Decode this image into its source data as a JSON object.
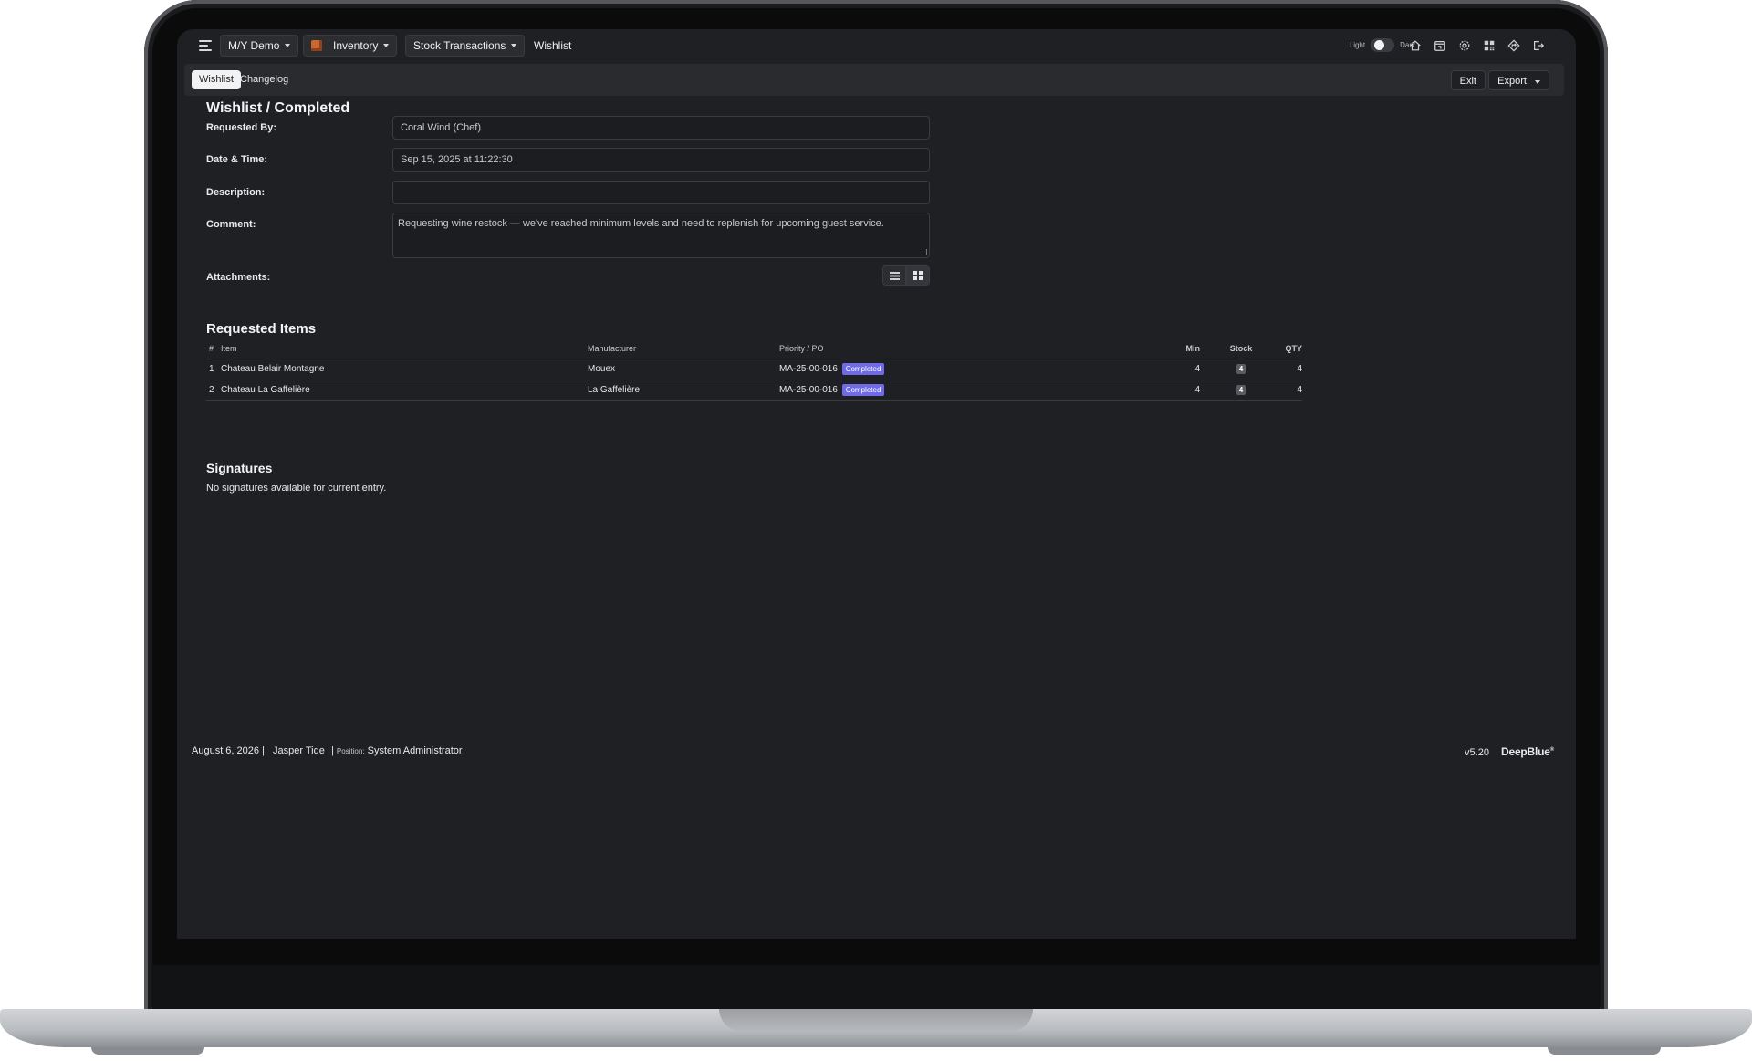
{
  "topnav": {
    "vessel": "M/Y Demo",
    "module": "Inventory",
    "section": "Stock Transactions",
    "page": "Wishlist",
    "theme_light": "Light",
    "theme_dark": "Dark"
  },
  "subbar": {
    "tabs": [
      "Wishlist",
      "Changelog"
    ],
    "exit_label": "Exit",
    "export_label": "Export"
  },
  "form": {
    "title": "Wishlist / Completed",
    "requested_by_label": "Requested By:",
    "requested_by_value": "Coral Wind (Chef)",
    "datetime_label": "Date & Time:",
    "datetime_value": "Sep 15, 2025 at 11:22:30",
    "description_label": "Description:",
    "description_value": "",
    "comment_label": "Comment:",
    "comment_value": "Requesting wine restock — we've reached minimum levels and need to replenish for upcoming guest service.",
    "attachments_label": "Attachments:"
  },
  "items": {
    "title": "Requested Items",
    "headers": [
      "#",
      "Item",
      "Manufacturer",
      "Priority / PO",
      "Min",
      "Stock",
      "QTY"
    ],
    "rows": [
      {
        "num": "1",
        "item": "Chateau Belair Montagne",
        "manufacturer": "Mouex",
        "po": "MA-25-00-016",
        "status": "Completed",
        "min": "4",
        "stock": "4",
        "qty": "4"
      },
      {
        "num": "2",
        "item": "Chateau La Gaffelière",
        "manufacturer": "La Gaffelière",
        "po": "MA-25-00-016",
        "status": "Completed",
        "min": "4",
        "stock": "4",
        "qty": "4"
      }
    ]
  },
  "signatures": {
    "title": "Signatures",
    "empty_text": "No signatures available for current entry."
  },
  "footer": {
    "date": "August 6, 2026",
    "user": "Jasper Tide",
    "position_label": "Position:",
    "position_value": "System Administrator",
    "version": "v5.20",
    "brand": "DeepBlue",
    "brand_mark": "®"
  },
  "colors": {
    "background": "#1f2024",
    "badge": "#6f6ae8",
    "accent_cube": "#c9692f"
  },
  "icons": [
    "menu-icon",
    "cube-icon",
    "home-icon",
    "calendar-icon",
    "gear-icon",
    "qr-icon",
    "diamond-arrow-icon",
    "logout-icon",
    "list-view-icon",
    "grid-view-icon"
  ]
}
